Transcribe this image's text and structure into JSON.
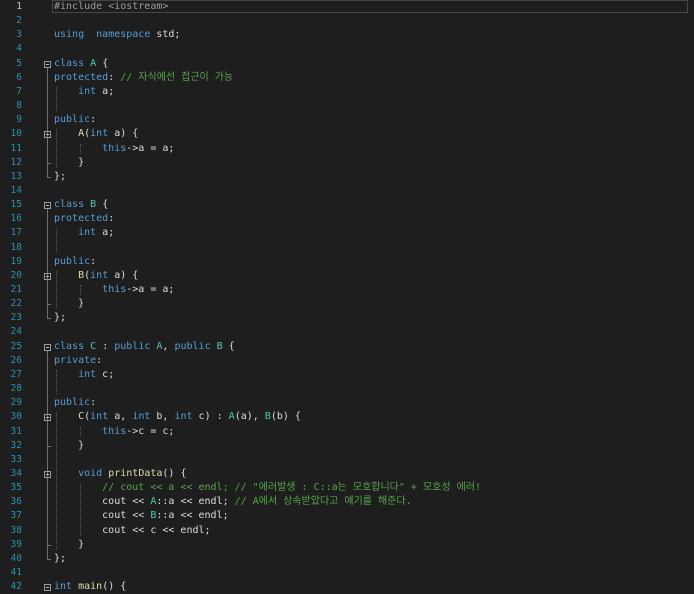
{
  "editor": {
    "active_line": 1,
    "lines": [
      [
        [
          "pp",
          "#include <iostream>"
        ]
      ],
      [],
      [
        [
          "kw",
          "using"
        ],
        [
          "",
          "  "
        ],
        [
          "kw",
          "namespace"
        ],
        [
          "",
          " std;"
        ]
      ],
      [],
      [
        [
          "kw",
          "class"
        ],
        [
          "",
          " "
        ],
        [
          "type",
          "A"
        ],
        [
          "",
          " {"
        ]
      ],
      [
        [
          "kw",
          "protected"
        ],
        [
          "",
          ": "
        ],
        [
          "cm",
          "// 자식에선 접근이 가능"
        ]
      ],
      [
        [
          "",
          "    "
        ],
        [
          "kw",
          "int"
        ],
        [
          "",
          " a;"
        ]
      ],
      [],
      [
        [
          "kw",
          "public"
        ],
        [
          "",
          ":"
        ]
      ],
      [
        [
          "",
          "    "
        ],
        [
          "fn",
          "A"
        ],
        [
          "",
          "("
        ],
        [
          "kw",
          "int"
        ],
        [
          "",
          " a) {"
        ]
      ],
      [
        [
          "",
          "        "
        ],
        [
          "kw",
          "this"
        ],
        [
          "",
          "->a = a;"
        ]
      ],
      [
        [
          "",
          "    }"
        ]
      ],
      [
        [
          "",
          "};"
        ]
      ],
      [],
      [
        [
          "kw",
          "class"
        ],
        [
          "",
          " "
        ],
        [
          "type",
          "B"
        ],
        [
          "",
          " {"
        ]
      ],
      [
        [
          "kw",
          "protected"
        ],
        [
          "",
          ":"
        ]
      ],
      [
        [
          "",
          "    "
        ],
        [
          "kw",
          "int"
        ],
        [
          "",
          " a;"
        ]
      ],
      [],
      [
        [
          "kw",
          "public"
        ],
        [
          "",
          ":"
        ]
      ],
      [
        [
          "",
          "    "
        ],
        [
          "fn",
          "B"
        ],
        [
          "",
          "("
        ],
        [
          "kw",
          "int"
        ],
        [
          "",
          " a) {"
        ]
      ],
      [
        [
          "",
          "        "
        ],
        [
          "kw",
          "this"
        ],
        [
          "",
          "->a = a;"
        ]
      ],
      [
        [
          "",
          "    }"
        ]
      ],
      [
        [
          "",
          "};"
        ]
      ],
      [],
      [
        [
          "kw",
          "class"
        ],
        [
          "",
          " "
        ],
        [
          "type",
          "C"
        ],
        [
          "",
          " : "
        ],
        [
          "kw",
          "public"
        ],
        [
          "",
          " "
        ],
        [
          "type",
          "A"
        ],
        [
          "",
          ", "
        ],
        [
          "kw",
          "public"
        ],
        [
          "",
          " "
        ],
        [
          "type",
          "B"
        ],
        [
          "",
          " {"
        ]
      ],
      [
        [
          "kw",
          "private"
        ],
        [
          "",
          ":"
        ]
      ],
      [
        [
          "",
          "    "
        ],
        [
          "kw",
          "int"
        ],
        [
          "",
          " c;"
        ]
      ],
      [],
      [
        [
          "kw",
          "public"
        ],
        [
          "",
          ":"
        ]
      ],
      [
        [
          "",
          "    "
        ],
        [
          "fn",
          "C"
        ],
        [
          "",
          "("
        ],
        [
          "kw",
          "int"
        ],
        [
          "",
          " a, "
        ],
        [
          "kw",
          "int"
        ],
        [
          "",
          " b, "
        ],
        [
          "kw",
          "int"
        ],
        [
          "",
          " c) : "
        ],
        [
          "type",
          "A"
        ],
        [
          "",
          "(a), "
        ],
        [
          "type",
          "B"
        ],
        [
          "",
          "(b) {"
        ]
      ],
      [
        [
          "",
          "        "
        ],
        [
          "kw",
          "this"
        ],
        [
          "",
          "->c = c;"
        ]
      ],
      [
        [
          "",
          "    }"
        ]
      ],
      [],
      [
        [
          "",
          "    "
        ],
        [
          "kw",
          "void"
        ],
        [
          "",
          " "
        ],
        [
          "fn",
          "printData"
        ],
        [
          "",
          "() {"
        ]
      ],
      [
        [
          "",
          "        "
        ],
        [
          "cm",
          "// cout << a << endl; // \"에러발생 : C::a는 모호합니다\" + 모호성 에러!"
        ]
      ],
      [
        [
          "",
          "        cout << "
        ],
        [
          "type",
          "A"
        ],
        [
          "",
          "::a << endl; "
        ],
        [
          "cm",
          "// A에서 상속받았다고 얘기를 해준다."
        ]
      ],
      [
        [
          "",
          "        cout << "
        ],
        [
          "type",
          "B"
        ],
        [
          "",
          "::a << endl;"
        ]
      ],
      [
        [
          "",
          "        cout << c << endl;"
        ]
      ],
      [
        [
          "",
          "    }"
        ]
      ],
      [
        [
          "",
          "};"
        ]
      ],
      [],
      [
        [
          "kw",
          "int"
        ],
        [
          "",
          " "
        ],
        [
          "fn",
          "main"
        ],
        [
          "",
          "() {"
        ]
      ]
    ]
  }
}
